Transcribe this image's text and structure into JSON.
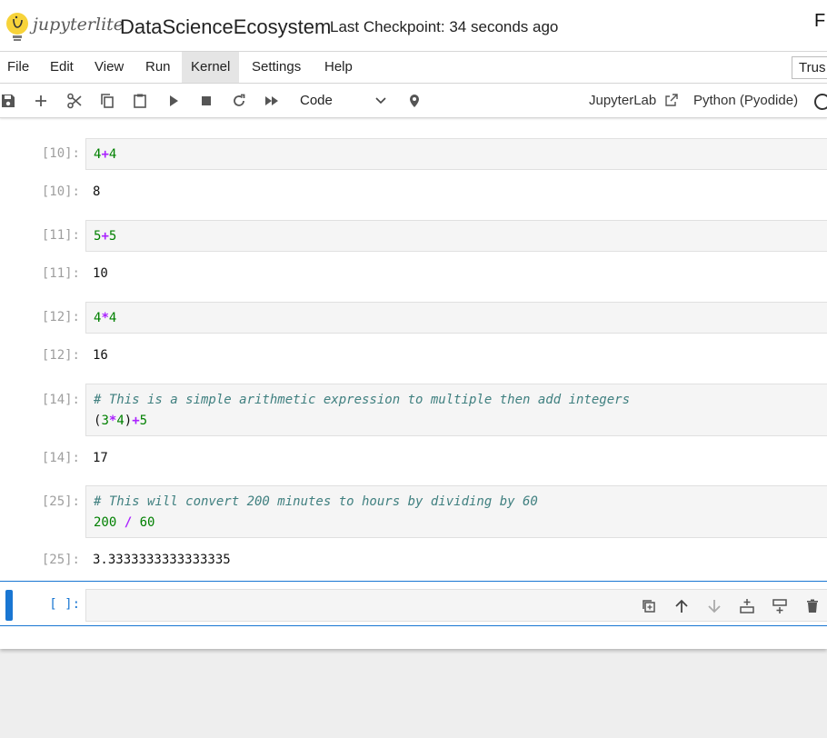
{
  "header": {
    "logo_text": "jupyterlite",
    "notebook_title": "DataScienceEcosystem",
    "checkpoint": "Last Checkpoint: 34 seconds ago",
    "user_glyph": "F"
  },
  "menu": {
    "items": [
      "File",
      "Edit",
      "View",
      "Run",
      "Kernel",
      "Settings",
      "Help"
    ],
    "active": "Kernel",
    "trusted_label": "Trus"
  },
  "toolbar": {
    "cell_type": "Code",
    "jupyterlab_link": "JupyterLab",
    "kernel_name": "Python (Pyodide)",
    "icons": [
      "save-icon",
      "add-icon",
      "cut-icon",
      "copy-icon",
      "paste-icon",
      "run-icon",
      "stop-icon",
      "restart-icon",
      "fast-forward-icon",
      "chevron-down-icon",
      "debug-icon",
      "external-link-icon",
      "kernel-status-icon"
    ]
  },
  "cells": [
    {
      "in_prompt": "[10]:",
      "out_prompt": "[10]:",
      "output": "8"
    },
    {
      "in_prompt": "[11]:",
      "out_prompt": "[11]:",
      "output": "10"
    },
    {
      "in_prompt": "[12]:",
      "out_prompt": "[12]:",
      "output": "16"
    },
    {
      "in_prompt": "[14]:",
      "out_prompt": "[14]:",
      "output": "17",
      "comment": "# This is a simple arithmetic expression to multiple then add integers"
    },
    {
      "in_prompt": "[25]:",
      "out_prompt": "[25]:",
      "output": "3.3333333333333335",
      "comment": "# This will convert 200 minutes to hours by dividing by 60"
    }
  ],
  "code": {
    "c0": [
      "4",
      "+",
      "4"
    ],
    "c1": [
      "5",
      "+",
      "5"
    ],
    "c2": [
      "4",
      "*",
      "4"
    ],
    "c3": [
      "(",
      "3",
      "*",
      "4",
      ")",
      "+",
      "5"
    ],
    "c4": [
      "200",
      " / ",
      "60"
    ]
  },
  "active_cell": {
    "prompt": "[ ]:",
    "tools": [
      "duplicate-icon",
      "move-up-icon",
      "move-down-icon",
      "insert-below-icon",
      "insert-above-icon",
      "delete-icon"
    ]
  },
  "colors": {
    "accent": "#1976d2",
    "number": "#008000",
    "operator": "#aa22ff",
    "comment": "#408080"
  }
}
